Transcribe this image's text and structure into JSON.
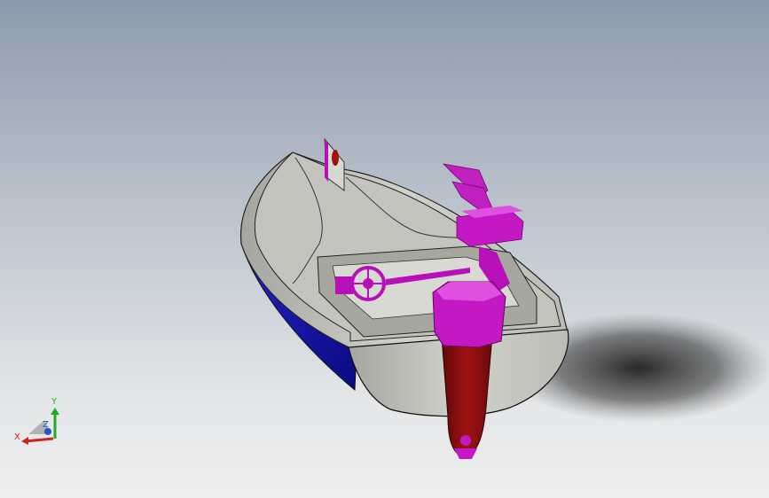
{
  "viewport": {
    "background_top": "#8e9aac",
    "background_bottom": "#eeeeee"
  },
  "model": {
    "hull_bottom_color": "#1a1aa8",
    "hull_color": "#c9c9c4",
    "deck_color": "#b3b3ad",
    "fitting_color": "#b810b8",
    "rudder_color": "#8f0d0d"
  },
  "triad": {
    "x_label": "X",
    "y_label": "Y",
    "z_label": "Z",
    "x_color": "#cc2222",
    "y_color": "#22aa22",
    "z_color": "#2255cc"
  }
}
